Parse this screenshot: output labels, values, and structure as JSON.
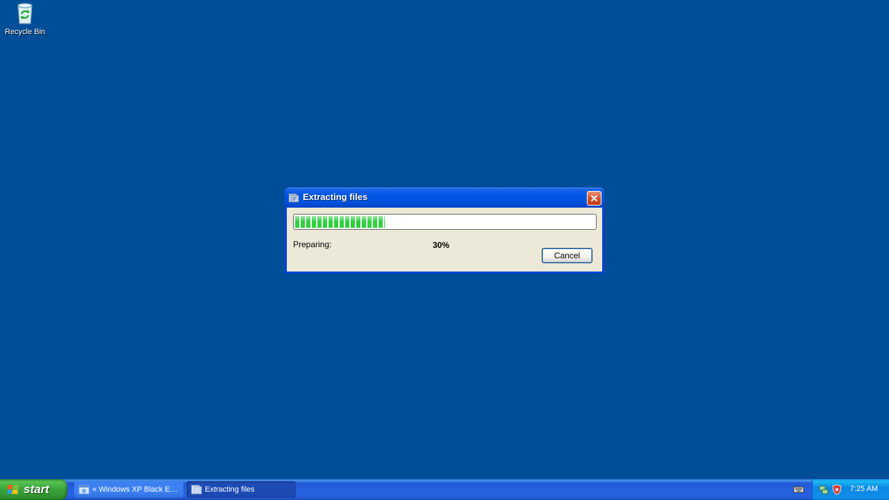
{
  "desktop": {
    "icons": [
      {
        "label": "Recycle Bin",
        "icon": "recycle-bin-icon"
      }
    ]
  },
  "dialog": {
    "title": "Extracting files",
    "title_icon": "extract-icon",
    "close_icon": "close-icon",
    "progress_fraction": 0.3,
    "status_label": "Preparing:",
    "percent_text": "30%",
    "cancel_label": "Cancel"
  },
  "taskbar": {
    "start_label": "start",
    "tasks": [
      {
        "label": "« Windows XP Black E…",
        "icon": "browser-window-icon",
        "active": false
      },
      {
        "label": "Extracting files",
        "icon": "extract-icon",
        "active": true
      }
    ],
    "tray": {
      "clock": "7:25 AM",
      "icons": [
        "keyboard-icon",
        "network-icon",
        "security-shield-icon"
      ]
    }
  },
  "colors": {
    "desktop_bg": "#004E98",
    "progress_fill": "#2ED13E",
    "taskbar_blue": "#245EDB",
    "start_green": "#3AA33A",
    "close_red": "#D9532C"
  }
}
